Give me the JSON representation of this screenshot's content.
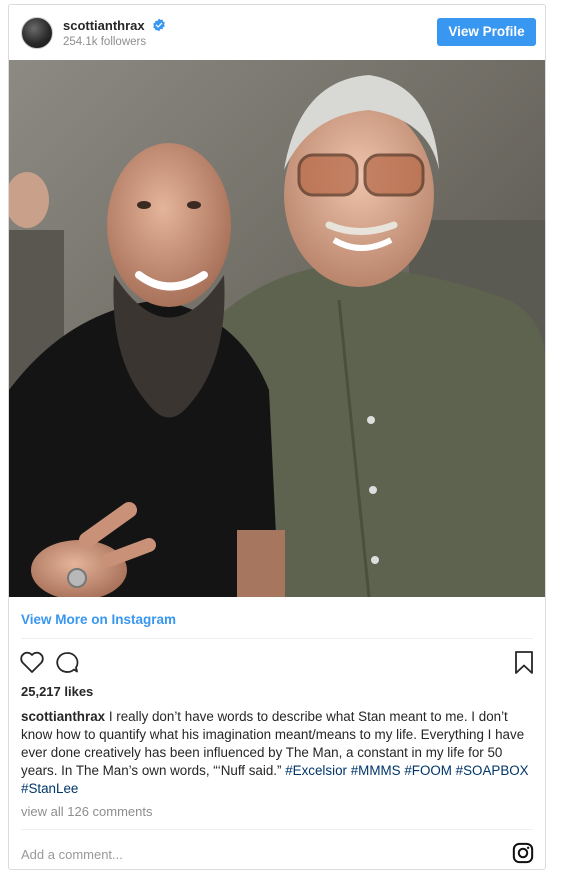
{
  "header": {
    "username": "scottianthrax",
    "followers": "254.1k followers",
    "view_profile": "View Profile"
  },
  "photo": {
    "alt": "Scott Ian with Stan Lee"
  },
  "link": {
    "view_more": "View More on Instagram"
  },
  "likes": "25,217 likes",
  "caption": {
    "username": "scottianthrax",
    "text": "I really don’t have words to describe what Stan meant to me. I don’t know how to quantify what his imagination meant/means to my life. Everything I have ever done creatively has been influenced by The Man, a constant in my life for 50 years. In The Man’s own words, “‘Nuff said.”",
    "tags": [
      "#Excelsior",
      "#MMMS",
      "#FOOM",
      "#SOAPBOX",
      "#StanLee"
    ]
  },
  "comments": "view all 126 comments",
  "add_comment_placeholder": "Add a comment...",
  "colors": {
    "accent": "#3897f0",
    "hashtag": "#003569",
    "muted": "#8e8e8e"
  },
  "icons": [
    "verified-badge-icon",
    "heart-icon",
    "comment-icon",
    "bookmark-icon",
    "instagram-logo-icon"
  ]
}
